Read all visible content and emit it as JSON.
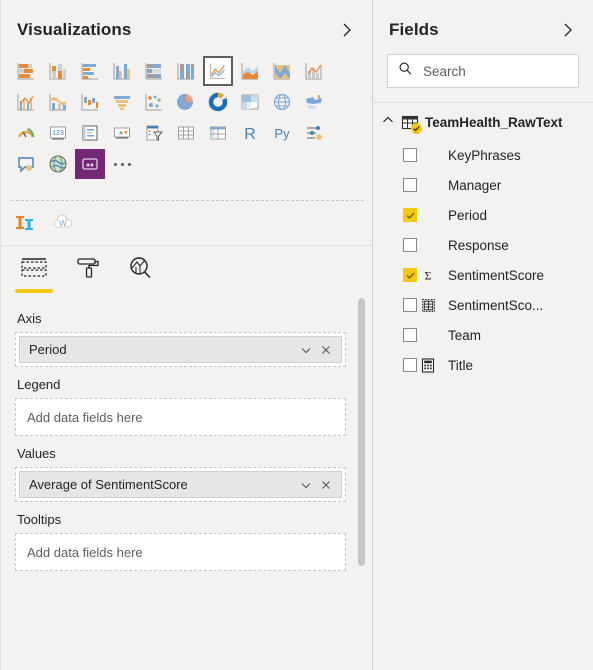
{
  "visualizations": {
    "title": "Visualizations",
    "collapse_icon": "chevron-right-icon",
    "gallery_rows": [
      [
        {
          "name": "stacked-bar-chart",
          "selected": false
        },
        {
          "name": "stacked-column-chart",
          "selected": false
        },
        {
          "name": "clustered-bar-chart",
          "selected": false
        },
        {
          "name": "clustered-column-chart",
          "selected": false
        },
        {
          "name": "100-percent-stacked-bar-chart",
          "selected": false
        },
        {
          "name": "100-percent-stacked-column-chart",
          "selected": false
        },
        {
          "name": "line-chart",
          "selected": true
        },
        {
          "name": "area-chart",
          "selected": false
        },
        {
          "name": "stacked-area-chart",
          "selected": false
        },
        {
          "name": "line-and-stacked-column-chart",
          "selected": false
        }
      ],
      [
        {
          "name": "line-and-clustered-column-chart",
          "selected": false
        },
        {
          "name": "ribbon-chart",
          "selected": false
        },
        {
          "name": "waterfall-chart",
          "selected": false
        },
        {
          "name": "funnel-chart",
          "selected": false
        },
        {
          "name": "scatter-chart",
          "selected": false
        },
        {
          "name": "pie-chart",
          "selected": false
        },
        {
          "name": "donut-chart",
          "selected": false
        },
        {
          "name": "treemap",
          "selected": false
        },
        {
          "name": "map",
          "selected": false
        },
        {
          "name": "filled-map",
          "selected": false
        }
      ],
      [
        {
          "name": "gauge-chart",
          "selected": false
        },
        {
          "name": "card",
          "selected": false
        },
        {
          "name": "multi-row-card",
          "selected": false
        },
        {
          "name": "kpi",
          "selected": false
        },
        {
          "name": "slicer",
          "selected": false
        },
        {
          "name": "table",
          "selected": false
        },
        {
          "name": "matrix",
          "selected": false
        },
        {
          "name": "r-script-visual",
          "selected": false
        },
        {
          "name": "python-visual",
          "selected": false
        },
        {
          "name": "key-influencers",
          "selected": false
        }
      ],
      [
        {
          "name": "qna-visual",
          "selected": false
        },
        {
          "name": "arcgis-maps-visual",
          "selected": false
        },
        {
          "name": "power-apps-visual",
          "selected": false
        }
      ]
    ],
    "more_options_label": "...",
    "custom_visuals": [
      {
        "name": "custom-visual-orange-blue"
      },
      {
        "name": "custom-visual-word-cloud"
      }
    ],
    "well_tabs": [
      {
        "name": "fields-tab",
        "icon": "fields-tab-icon",
        "active": true
      },
      {
        "name": "format-tab",
        "icon": "paint-roller-icon",
        "active": false
      },
      {
        "name": "analytics-tab",
        "icon": "analytics-magnifier-icon",
        "active": false
      }
    ],
    "wells": [
      {
        "label": "Axis",
        "placeholder": "Add data fields here",
        "chips": [
          {
            "label": "Period",
            "dropdown_icon": "chevron-down-icon",
            "remove_icon": "close-icon"
          }
        ]
      },
      {
        "label": "Legend",
        "placeholder": "Add data fields here",
        "chips": []
      },
      {
        "label": "Values",
        "placeholder": "Add data fields here",
        "chips": [
          {
            "label": "Average of SentimentScore",
            "dropdown_icon": "chevron-down-icon",
            "remove_icon": "close-icon"
          }
        ]
      },
      {
        "label": "Tooltips",
        "placeholder": "Add data fields here",
        "chips": []
      }
    ]
  },
  "fields": {
    "title": "Fields",
    "collapse_icon": "chevron-right-icon",
    "search": {
      "placeholder": "Search",
      "value": "",
      "icon": "search-icon"
    },
    "table": {
      "name": "TeamHealth_RawText",
      "expand_icon": "chevron-up-icon",
      "table_icon": "table-icon",
      "badge_icon": "check-badge-icon",
      "expanded": true
    },
    "field_items": [
      {
        "label": "KeyPhrases",
        "checked": false,
        "icon": "none"
      },
      {
        "label": "Manager",
        "checked": false,
        "icon": "none"
      },
      {
        "label": "Period",
        "checked": true,
        "icon": "none"
      },
      {
        "label": "Response",
        "checked": false,
        "icon": "none"
      },
      {
        "label": "SentimentScore",
        "checked": true,
        "icon": "sigma-icon"
      },
      {
        "label": "SentimentSco...",
        "checked": false,
        "icon": "table-grid-icon"
      },
      {
        "label": "Team",
        "checked": false,
        "icon": "none"
      },
      {
        "label": "Title",
        "checked": false,
        "icon": "calculator-icon"
      }
    ]
  },
  "colors": {
    "accent_yellow": "#f2c811",
    "panel_bg": "#f3f2f1",
    "border": "#e1dfdd",
    "text": "#252423",
    "muted_text": "#605e5c",
    "chip_bg": "#e8e6e4",
    "chart_orange": "#e8883a",
    "chart_blue": "#7fa9d4",
    "purple_visual": "#742774"
  }
}
